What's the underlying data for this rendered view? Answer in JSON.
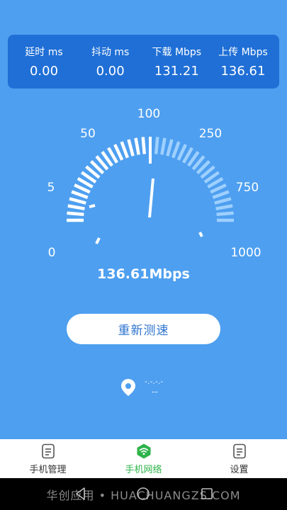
{
  "stats": [
    {
      "label": "延时 ms",
      "value": "0.00"
    },
    {
      "label": "抖动 ms",
      "value": "0.00"
    },
    {
      "label": "下载 Mbps",
      "value": "131.21"
    },
    {
      "label": "上传 Mbps",
      "value": "136.61"
    }
  ],
  "gauge": {
    "scale_labels": [
      "0",
      "5",
      "50",
      "100",
      "250",
      "750",
      "1000"
    ],
    "needle_value_label": "100",
    "speed_text": "136.61Mbps",
    "colors": {
      "ticks": "#ffffff",
      "active_ticks": "#9ed0ff",
      "needle": "#ffffff"
    }
  },
  "retest_button": "重新测速",
  "location": {
    "name": "-.-.-.-",
    "sub": "--"
  },
  "nav": {
    "items": [
      {
        "label": "手机管理",
        "icon": "document-icon",
        "active": false
      },
      {
        "label": "手机网络",
        "icon": "wifi-icon",
        "active": true
      },
      {
        "label": "设置",
        "icon": "document-icon",
        "active": false
      }
    ]
  },
  "watermark": "华创应用 • HUACHUANGZS.COM",
  "colors": {
    "background": "#4e9ff0",
    "card": "#1f6fd6",
    "accent_green": "#2db34a"
  }
}
